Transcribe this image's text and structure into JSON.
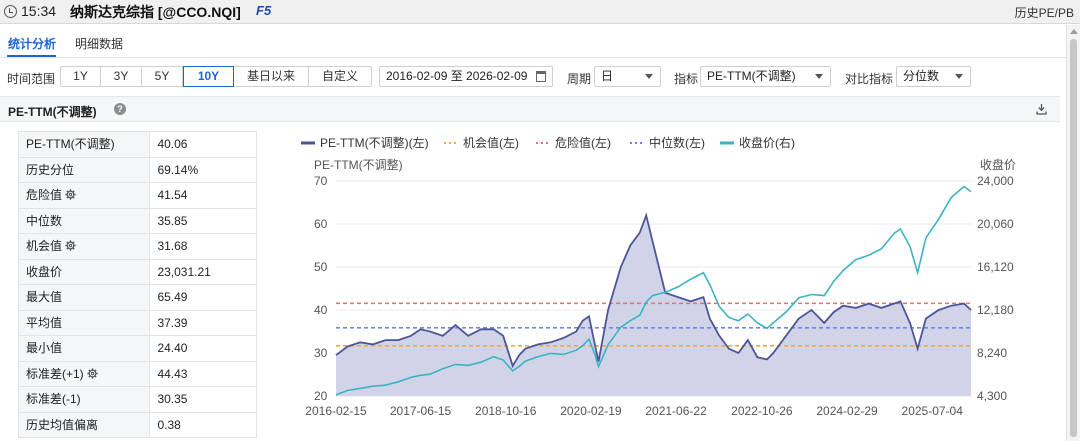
{
  "titlebar": {
    "time": "15:34",
    "title": "纳斯达克综指 [@CCO.NQI]",
    "hotkey": "F5",
    "right_label": "历史PE/PB"
  },
  "tabs": [
    {
      "label": "统计分析",
      "active": true
    },
    {
      "label": "明细数据",
      "active": false
    }
  ],
  "toolbar": {
    "range_label": "时间范围",
    "ranges": [
      {
        "label": "1Y",
        "selected": false
      },
      {
        "label": "3Y",
        "selected": false
      },
      {
        "label": "5Y",
        "selected": false
      },
      {
        "label": "10Y",
        "selected": true
      },
      {
        "label": "基日以来",
        "selected": false
      },
      {
        "label": "自定义",
        "selected": false
      }
    ],
    "date_range": "2016-02-09 至 2026-02-09",
    "period_label": "周期",
    "period_value": "日",
    "metric_label": "指标",
    "metric_value": "PE-TTM(不调整)",
    "compare_label": "对比指标",
    "compare_value": "分位数"
  },
  "section": {
    "title": "PE-TTM(不调整)"
  },
  "stats": [
    {
      "label": "PE-TTM(不调整)",
      "value": "40.06",
      "gear": false
    },
    {
      "label": "历史分位",
      "value": "69.14%",
      "gear": false
    },
    {
      "label": "危险值",
      "value": "41.54",
      "gear": true
    },
    {
      "label": "中位数",
      "value": "35.85",
      "gear": false
    },
    {
      "label": "机会值",
      "value": "31.68",
      "gear": true
    },
    {
      "label": "收盘价",
      "value": "23,031.21",
      "gear": false
    },
    {
      "label": "最大值",
      "value": "65.49",
      "gear": false
    },
    {
      "label": "平均值",
      "value": "37.39",
      "gear": false
    },
    {
      "label": "最小值",
      "value": "24.40",
      "gear": false
    },
    {
      "label": "标准差(+1)",
      "value": "44.43",
      "gear": true
    },
    {
      "label": "标准差(-1)",
      "value": "30.35",
      "gear": false
    },
    {
      "label": "历史均值偏离",
      "value": "0.38",
      "gear": false
    }
  ],
  "colors": {
    "pe": "#4d5596",
    "pe_fill": "#c9cce4",
    "opportunity": "#f2a93b",
    "danger": "#e8706a",
    "median": "#6f86e8",
    "price": "#3bb3c3",
    "accent": "#1e63d8"
  },
  "chart_data": {
    "type": "line",
    "legend": [
      "PE-TTM(不调整)(左)",
      "机会值(左)",
      "危险值(左)",
      "中位数(左)",
      "收盘价(右)"
    ],
    "ylabel_left": "PE-TTM(不调整)",
    "ylabel_right": "收盘价",
    "left_axis": {
      "range": [
        20,
        70
      ],
      "ticks": [
        "70",
        "60",
        "50",
        "40",
        "30",
        "20"
      ]
    },
    "right_axis": {
      "range": [
        4300,
        24000
      ],
      "ticks": [
        "24,000",
        "20,060",
        "16,120",
        "12,180",
        "8,240",
        "4,300"
      ]
    },
    "x_ticks": [
      "2016-02-15",
      "2017-06-15",
      "2018-10-16",
      "2020-02-19",
      "2021-06-22",
      "2022-10-26",
      "2024-02-29",
      "2025-07-04"
    ],
    "reference_lines": {
      "danger": 41.54,
      "median": 35.85,
      "opportunity": 31.68
    },
    "x": [
      2016.12,
      2016.3,
      2016.5,
      2016.7,
      2016.9,
      2017.1,
      2017.3,
      2017.45,
      2017.6,
      2017.8,
      2018.0,
      2018.2,
      2018.4,
      2018.6,
      2018.75,
      2018.9,
      2019.0,
      2019.1,
      2019.3,
      2019.5,
      2019.7,
      2019.9,
      2020.0,
      2020.1,
      2020.2,
      2020.25,
      2020.4,
      2020.6,
      2020.75,
      2020.9,
      2021.0,
      2021.1,
      2021.3,
      2021.5,
      2021.7,
      2021.9,
      2022.0,
      2022.15,
      2022.3,
      2022.45,
      2022.6,
      2022.75,
      2022.9,
      2023.0,
      2023.2,
      2023.4,
      2023.6,
      2023.8,
      2023.95,
      2024.1,
      2024.3,
      2024.5,
      2024.7,
      2024.9,
      2025.0,
      2025.15,
      2025.27,
      2025.4,
      2025.6,
      2025.8,
      2026.0,
      2026.11
    ],
    "series": [
      {
        "name": "PE-TTM(不调整)(左)",
        "axis": "left",
        "values": [
          29.5,
          31.5,
          32.5,
          32.0,
          33.0,
          33.0,
          34.0,
          35.5,
          35.0,
          34.0,
          36.5,
          34.0,
          35.5,
          35.5,
          34.0,
          27.0,
          29.5,
          31.0,
          32.0,
          32.5,
          33.5,
          35.0,
          37.5,
          38.5,
          31.5,
          28.0,
          40.0,
          50.0,
          55.0,
          58.0,
          62.0,
          56.0,
          44.0,
          43.0,
          42.0,
          43.0,
          38.0,
          34.0,
          31.0,
          30.0,
          33.0,
          29.0,
          28.5,
          30.0,
          34.0,
          38.0,
          40.0,
          37.0,
          39.5,
          41.0,
          40.5,
          41.5,
          40.5,
          41.5,
          42.0,
          37.0,
          31.0,
          38.0,
          40.0,
          41.0,
          41.5,
          40.0
        ]
      },
      {
        "name": "收盘价(右)",
        "axis": "right",
        "values": [
          4400,
          4800,
          5000,
          5200,
          5300,
          5600,
          6000,
          6200,
          6300,
          6800,
          7200,
          7100,
          7400,
          7900,
          7600,
          6600,
          7000,
          7500,
          7900,
          8200,
          8100,
          8500,
          8900,
          9500,
          8000,
          7000,
          9000,
          10600,
          11200,
          11700,
          12900,
          13500,
          13800,
          14300,
          15000,
          15600,
          14500,
          12500,
          11500,
          11200,
          11800,
          11000,
          10500,
          11000,
          12000,
          13300,
          13600,
          13500,
          14800,
          15800,
          16800,
          17200,
          17800,
          19200,
          19600,
          18000,
          15600,
          18800,
          20500,
          22500,
          23500,
          23031
        ]
      }
    ]
  }
}
